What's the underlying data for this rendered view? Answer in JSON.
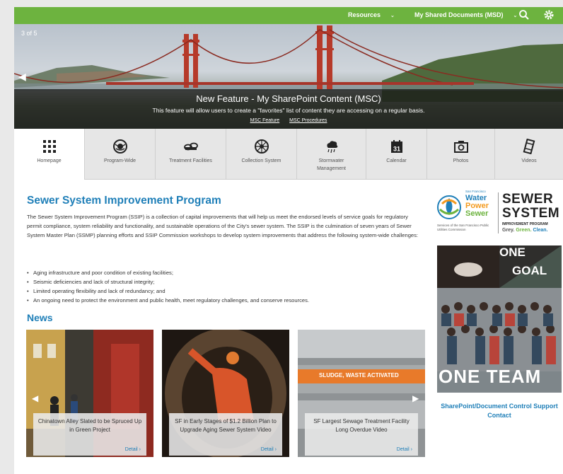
{
  "topbar": {
    "bg": "#6db33f",
    "nav": [
      {
        "label": "Resources"
      },
      {
        "label": "My Shared Documents (MSD)"
      }
    ],
    "icons": [
      "search-icon",
      "gear-icon"
    ]
  },
  "hero": {
    "counter": "3 of 5",
    "title": "New Feature - My SharePoint Content (MSC)",
    "text": "This feature will allow users to create a \"favorites\" list of content they are accessing on a regular basis.",
    "links": [
      "MSC Feature",
      "MSC Procedures"
    ]
  },
  "tiles": [
    {
      "label": "Homepage",
      "icon": "grid-icon",
      "active": true
    },
    {
      "label": "Program-Wide",
      "icon": "globe-icon"
    },
    {
      "label": "Treatment Facilities",
      "icon": "pipes-icon"
    },
    {
      "label": "Collection System",
      "icon": "wheel-icon"
    },
    {
      "label": "Stormwater Management",
      "icon": "rain-cloud-icon"
    },
    {
      "label": "Calendar",
      "icon": "calendar-icon",
      "day": "31"
    },
    {
      "label": "Photos",
      "icon": "camera-icon"
    },
    {
      "label": "Videos",
      "icon": "film-icon"
    }
  ],
  "main": {
    "title": "Sewer System Improvement Program",
    "paragraph": "The Sewer System Improvement Program (SSIP) is a collection of capital improvements that will help us meet the endorsed levels of service goals for regulatory permit compliance, system reliability and functionality, and sustainable operations of the City's sewer system. The SSIP is the culmination of seven years of Sewer System Master Plan (SSMP) planning efforts and SSIP Commission workshops to develop system improvements that address the following system-wide challenges:",
    "bullets": [
      "Aging infrastructure and poor condition of existing facilities;",
      "Seismic deficiencies and lack of structural integrity;",
      "Limited operating flexibility and lack of redundancy; and",
      "An ongoing need to protect the environment and public health, meet regulatory challenges, and conserve resources."
    ],
    "news_heading": "News",
    "news": [
      {
        "title": "Chinatown Alley Slated to be Spruced Up in Green Project",
        "detail": "Detail"
      },
      {
        "title": "SF in Early Stages of $1.2 Billion Plan to Upgrade Aging Sewer System Video",
        "detail": "Detail"
      },
      {
        "title": "SF Largest Sewage Treatment Facility Long Overdue Video",
        "detail": "Detail",
        "sign": "SLUDGE, WASTE ACTIVATED"
      }
    ]
  },
  "sidebar": {
    "logo": {
      "sf": "San Francisco",
      "water": "Water",
      "power": "Power",
      "sewer": "Sewer",
      "services": "Services of the San Francisco Public Utilities Commission",
      "ss1": "SEWER",
      "ss2": "SYSTEM",
      "ip": "IMPROVEMENT PROGRAM",
      "ggc": [
        "Grey.",
        "Green.",
        "Clean."
      ]
    },
    "promo": {
      "one": "ONE",
      "goal": "GOAL",
      "team": "ONE TEAM"
    },
    "link": "SharePoint/Document Control Support Contact"
  },
  "colors": {
    "accent": "#1f7fb8",
    "green": "#6db33f",
    "orange": "#f39a1f"
  }
}
